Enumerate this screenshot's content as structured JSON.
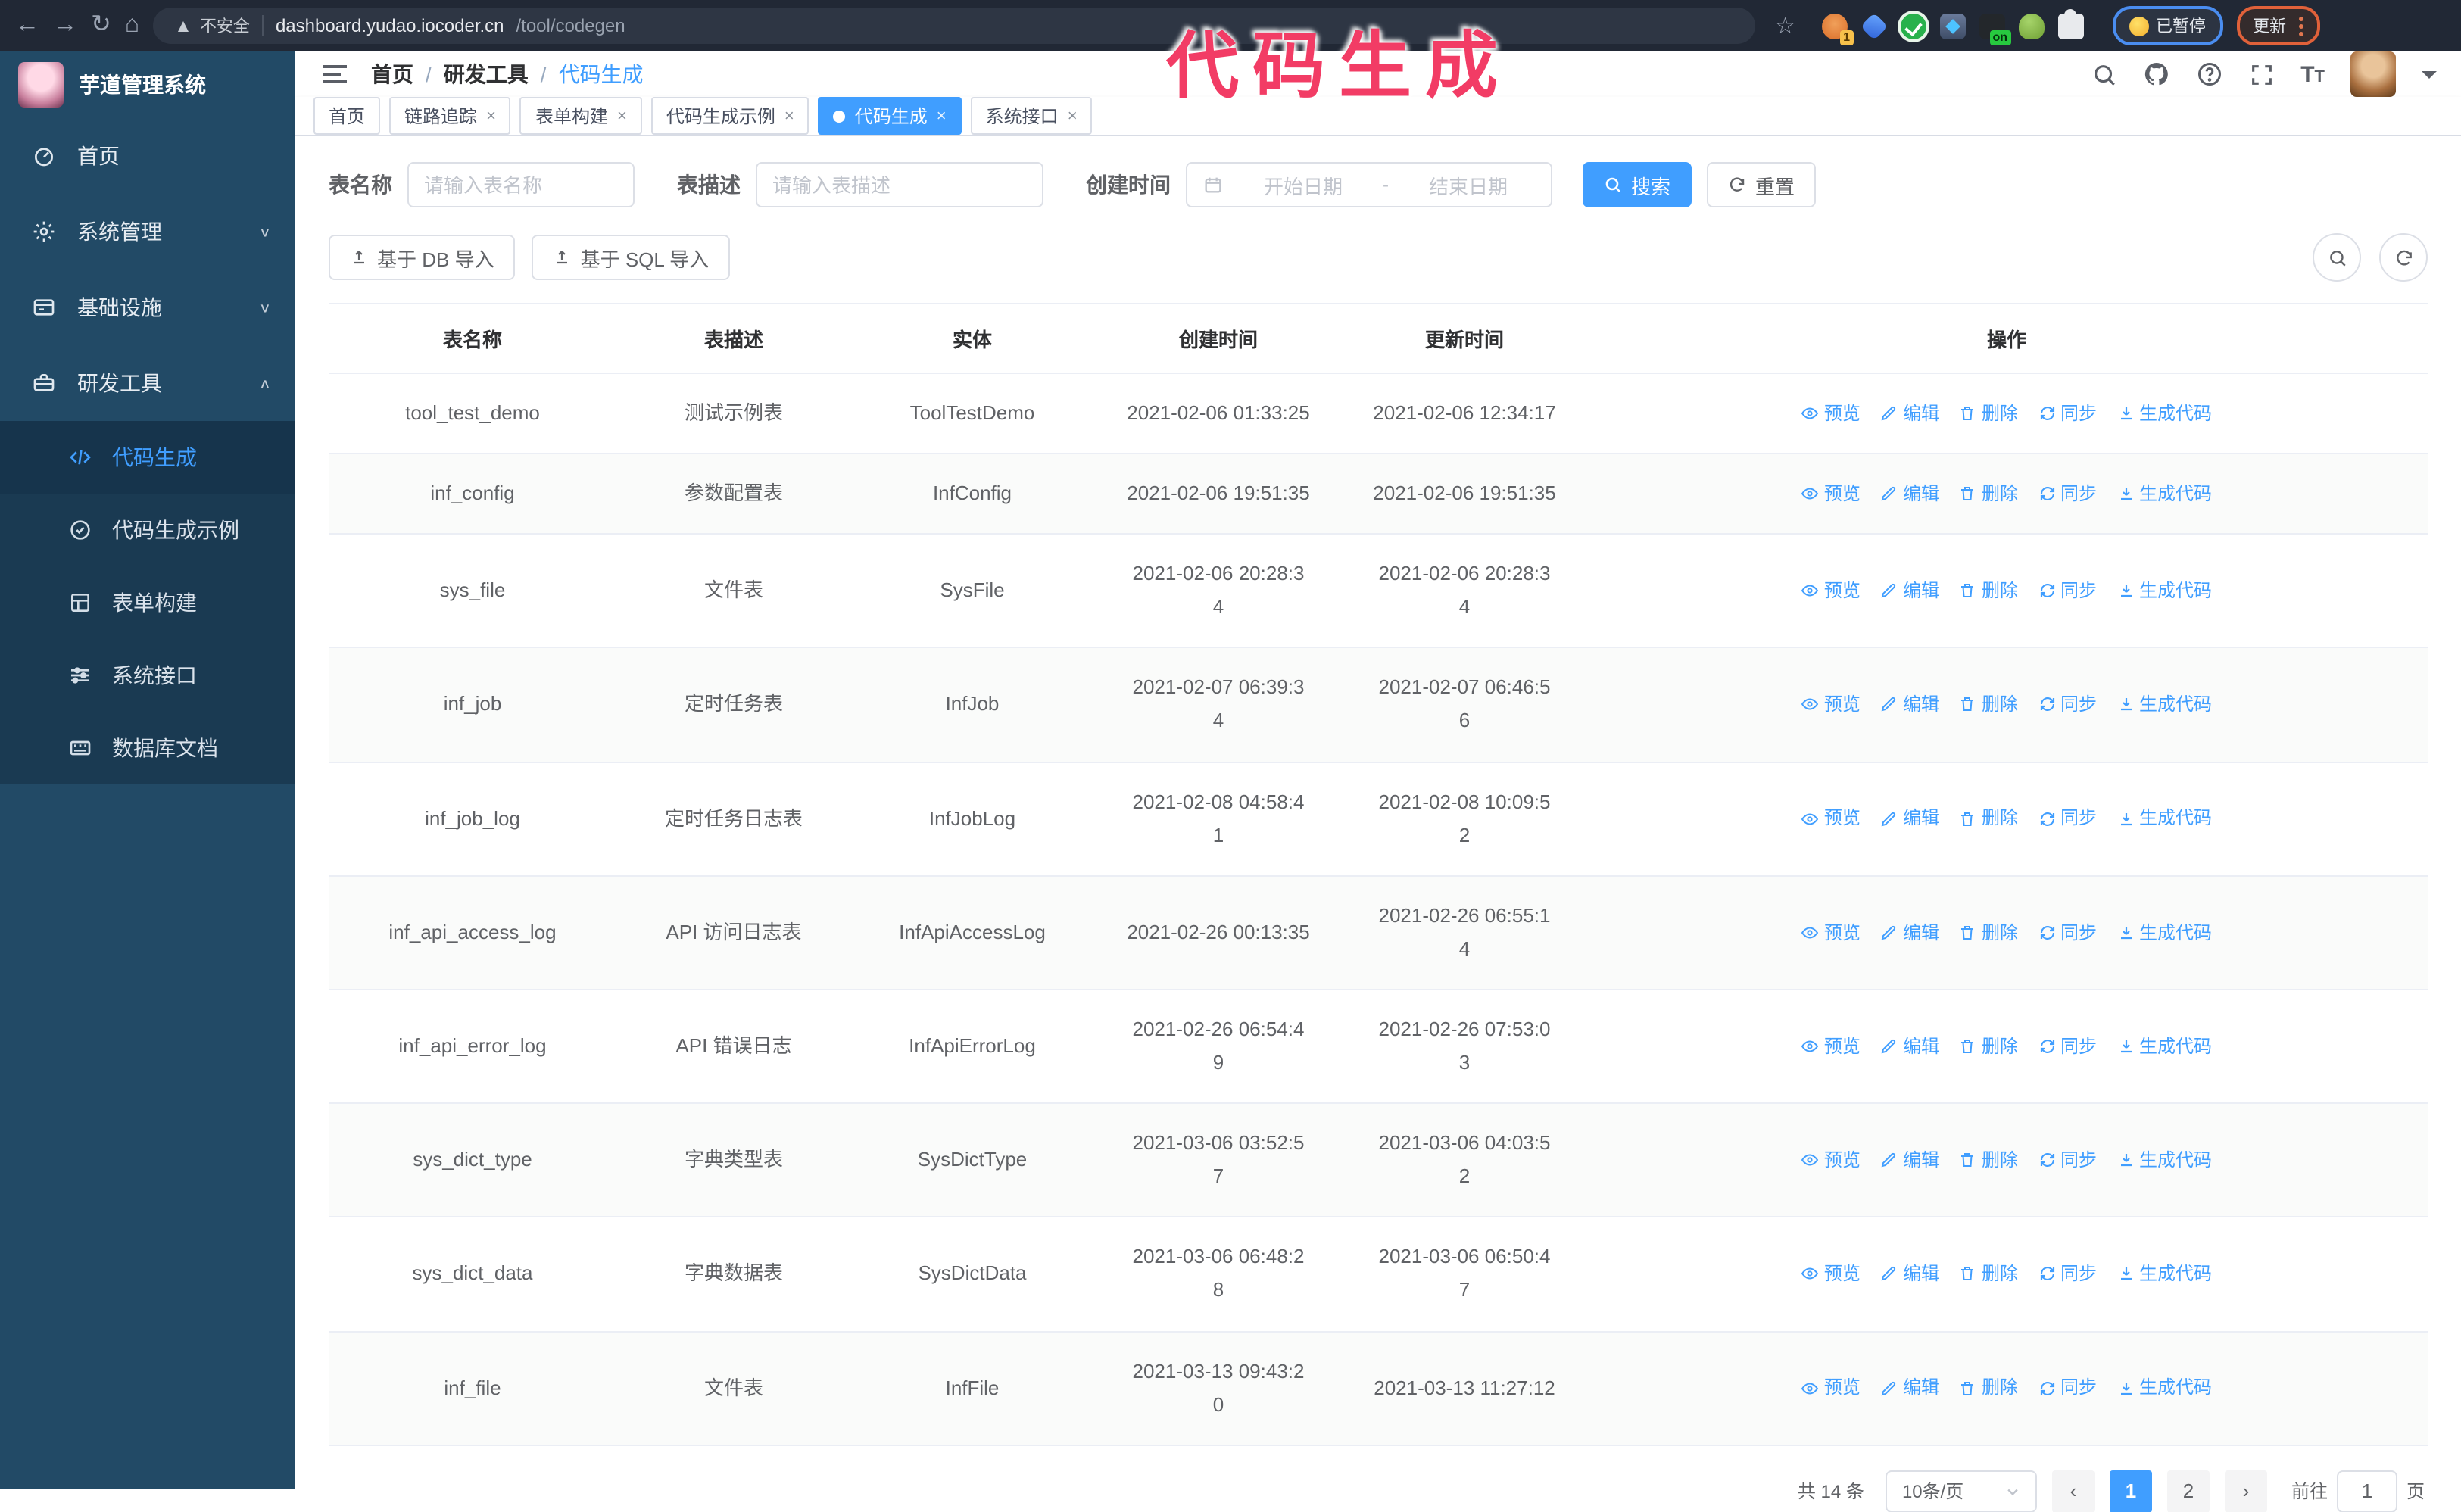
{
  "accent_color": "#409EFF",
  "browser": {
    "security_label": "不安全",
    "url_domain": "dashboard.yudao.iocoder.cn",
    "url_path": "/tool/codegen",
    "extensions": [
      {
        "icon": "orange-ext-icon",
        "badge": "1"
      },
      {
        "icon": "gem-ext-icon",
        "badge": ""
      },
      {
        "icon": "check-ext-icon",
        "badge": ""
      },
      {
        "icon": "grid-ext-icon",
        "badge": ""
      },
      {
        "icon": "dark-ext-icon",
        "badge": "on"
      },
      {
        "icon": "bot-ext-icon",
        "badge": ""
      },
      {
        "icon": "puzzle-ext-icon",
        "badge": ""
      }
    ],
    "paused_badge": "已暂停",
    "update_button": "更新"
  },
  "annotation": {
    "text": "代码生成",
    "color": "#f23c65"
  },
  "sidebar": {
    "app_title": "芋道管理系统",
    "items": [
      {
        "label": "首页",
        "icon": "dashboard-icon",
        "chevron": ""
      },
      {
        "label": "系统管理",
        "icon": "gear-icon",
        "chevron": "down"
      },
      {
        "label": "基础设施",
        "icon": "infrastructure-icon",
        "chevron": "down"
      },
      {
        "label": "研发工具",
        "icon": "tools-icon",
        "chevron": "up"
      }
    ],
    "sub_items": [
      {
        "label": "代码生成",
        "icon": "code-icon",
        "active": true
      },
      {
        "label": "代码生成示例",
        "icon": "badge-check-icon",
        "active": false
      },
      {
        "label": "表单构建",
        "icon": "form-grid-icon",
        "active": false
      },
      {
        "label": "系统接口",
        "icon": "sliders-icon",
        "active": false
      },
      {
        "label": "数据库文档",
        "icon": "database-doc-icon",
        "active": false
      }
    ]
  },
  "header": {
    "breadcrumb": [
      "首页",
      "研发工具",
      "代码生成"
    ]
  },
  "tabs": [
    {
      "label": "首页",
      "closable": false,
      "active": false
    },
    {
      "label": "链路追踪",
      "closable": true,
      "active": false
    },
    {
      "label": "表单构建",
      "closable": true,
      "active": false
    },
    {
      "label": "代码生成示例",
      "closable": true,
      "active": false
    },
    {
      "label": "代码生成",
      "closable": true,
      "active": true
    },
    {
      "label": "系统接口",
      "closable": true,
      "active": false
    }
  ],
  "filters": {
    "name_label": "表名称",
    "name_placeholder": "请输入表名称",
    "desc_label": "表描述",
    "desc_placeholder": "请输入表描述",
    "time_label": "创建时间",
    "start_placeholder": "开始日期",
    "range_separator": "-",
    "end_placeholder": "结束日期",
    "search_label": "搜索",
    "reset_label": "重置"
  },
  "toolbar": {
    "import_db_label": "基于 DB 导入",
    "import_sql_label": "基于 SQL 导入"
  },
  "table": {
    "columns": [
      "表名称",
      "表描述",
      "实体",
      "创建时间",
      "更新时间",
      "操作"
    ],
    "actions": [
      {
        "label": "预览",
        "icon": "eye-icon"
      },
      {
        "label": "编辑",
        "icon": "edit-icon"
      },
      {
        "label": "删除",
        "icon": "delete-icon"
      },
      {
        "label": "同步",
        "icon": "sync-icon"
      },
      {
        "label": "生成代码",
        "icon": "download-icon"
      }
    ],
    "rows": [
      {
        "name": "tool_test_demo",
        "desc": "测试示例表",
        "entity": "ToolTestDemo",
        "created": "2021-02-06 01:33:25",
        "updated": "2021-02-06 12:34:17"
      },
      {
        "name": "inf_config",
        "desc": "参数配置表",
        "entity": "InfConfig",
        "created": "2021-02-06 19:51:35",
        "updated": "2021-02-06 19:51:35"
      },
      {
        "name": "sys_file",
        "desc": "文件表",
        "entity": "SysFile",
        "created": "2021-02-06 20:28:3\n4",
        "updated": "2021-02-06 20:28:3\n4"
      },
      {
        "name": "inf_job",
        "desc": "定时任务表",
        "entity": "InfJob",
        "created": "2021-02-07 06:39:3\n4",
        "updated": "2021-02-07 06:46:5\n6"
      },
      {
        "name": "inf_job_log",
        "desc": "定时任务日志表",
        "entity": "InfJobLog",
        "created": "2021-02-08 04:58:4\n1",
        "updated": "2021-02-08 10:09:5\n2"
      },
      {
        "name": "inf_api_access_log",
        "desc": "API 访问日志表",
        "entity": "InfApiAccessLog",
        "created": "2021-02-26 00:13:35",
        "updated": "2021-02-26 06:55:1\n4"
      },
      {
        "name": "inf_api_error_log",
        "desc": "API 错误日志",
        "entity": "InfApiErrorLog",
        "created": "2021-02-26 06:54:4\n9",
        "updated": "2021-02-26 07:53:0\n3"
      },
      {
        "name": "sys_dict_type",
        "desc": "字典类型表",
        "entity": "SysDictType",
        "created": "2021-03-06 03:52:5\n7",
        "updated": "2021-03-06 04:03:5\n2"
      },
      {
        "name": "sys_dict_data",
        "desc": "字典数据表",
        "entity": "SysDictData",
        "created": "2021-03-06 06:48:2\n8",
        "updated": "2021-03-06 06:50:4\n7"
      },
      {
        "name": "inf_file",
        "desc": "文件表",
        "entity": "InfFile",
        "created": "2021-03-13 09:43:2\n0",
        "updated": "2021-03-13 11:27:12"
      }
    ]
  },
  "pagination": {
    "total": "共 14 条",
    "page_size": "10条/页",
    "pages": [
      "1",
      "2"
    ],
    "active_page": "1",
    "goto_label": "前往",
    "goto_value": "1",
    "page_suffix": "页"
  }
}
